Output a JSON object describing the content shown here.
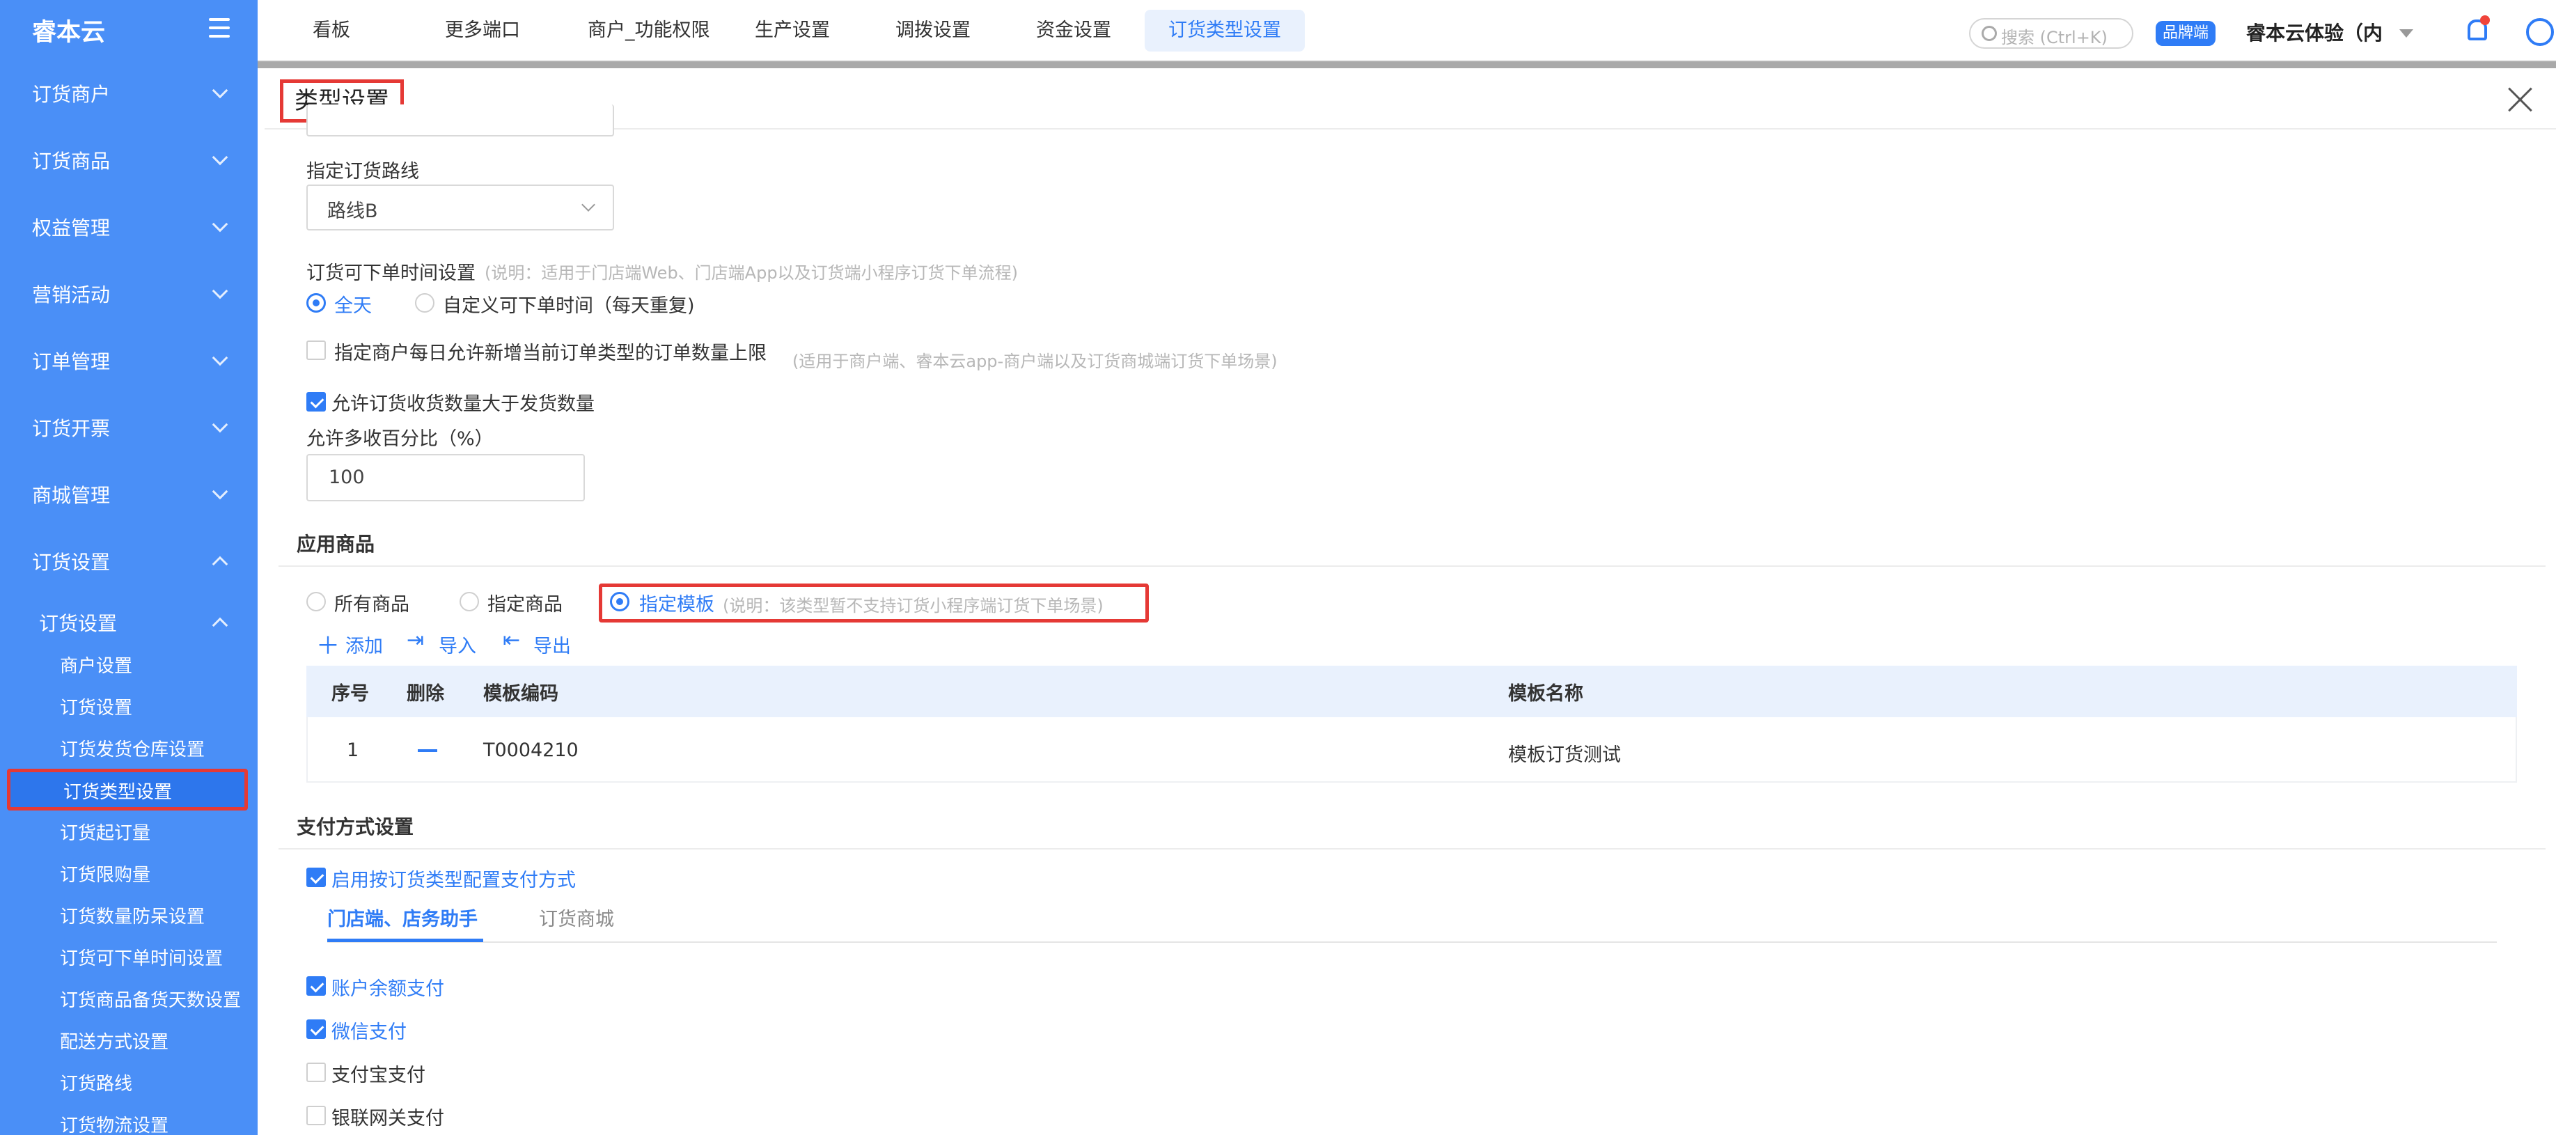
{
  "sidebar": {
    "logo": "睿本云",
    "groups": [
      {
        "label": "订货商户"
      },
      {
        "label": "订货商品"
      },
      {
        "label": "权益管理"
      },
      {
        "label": "营销活动"
      },
      {
        "label": "订单管理"
      },
      {
        "label": "订货开票"
      },
      {
        "label": "商城管理"
      },
      {
        "label": "订货设置"
      }
    ],
    "subgroup": "订货设置",
    "items": [
      {
        "label": "商户设置"
      },
      {
        "label": "订货设置"
      },
      {
        "label": "订货发货仓库设置"
      },
      {
        "label": "订货类型设置"
      },
      {
        "label": "订货起订量"
      },
      {
        "label": "订货限购量"
      },
      {
        "label": "订货数量防呆设置"
      },
      {
        "label": "订货可下单时间设置"
      },
      {
        "label": "订货商品备货天数设置"
      },
      {
        "label": "配送方式设置"
      },
      {
        "label": "订货路线"
      },
      {
        "label": "订货物流设置"
      }
    ]
  },
  "topnav": {
    "tabs": [
      {
        "label": "看板"
      },
      {
        "label": "更多端口"
      },
      {
        "label": "商户_功能权限"
      },
      {
        "label": "生产设置"
      },
      {
        "label": "调拨设置"
      },
      {
        "label": "资金设置"
      },
      {
        "label": "订货类型设置"
      }
    ],
    "search_placeholder": "搜索 (Ctrl+K)",
    "badge": "品牌端",
    "user": "睿本云体验（内"
  },
  "dialog": {
    "title": "类型设置",
    "route_label": "指定订货路线",
    "route_value": "路线B",
    "time_label": "订货可下单时间设置",
    "time_note": "(说明：适用于门店端Web、门店端App以及订货端小程序订货下单流程)",
    "time_opt_all": "全天",
    "time_opt_custom": "自定义可下单时间（每天重复)",
    "limit_label": "指定商户每日允许新增当前订单类型的订单数量上限",
    "limit_note": "(适用于商户端、睿本云app-商户端以及订货商城端订货下单场景)",
    "over_label": "允许订货收货数量大于发货数量",
    "pct_label": "允许多收百分比（%）",
    "pct_value": "100",
    "goods_section": "应用商品",
    "goods_all": "所有商品",
    "goods_specific": "指定商品",
    "goods_template": "指定模板",
    "goods_template_note": "(说明：该类型暂不支持订货小程序端订货下单场景)",
    "tool_add": "添加",
    "tool_import": "导入",
    "tool_export": "导出",
    "table": {
      "headers": [
        "序号",
        "删除",
        "模板编码",
        "模板名称"
      ],
      "rows": [
        {
          "no": "1",
          "code": "T0004210",
          "name": "模板订货测试"
        }
      ]
    },
    "pay_section": "支付方式设置",
    "pay_enable": "启用按订货类型配置支付方式",
    "pay_tabs": [
      "门店端、店务助手",
      "订货商城"
    ],
    "pay_methods": [
      {
        "label": "账户余额支付",
        "checked": true
      },
      {
        "label": "微信支付",
        "checked": true
      },
      {
        "label": "支付宝支付",
        "checked": false
      },
      {
        "label": "银联网关支付",
        "checked": false
      }
    ]
  },
  "colors": {
    "accent": "#2f7cf6",
    "sidebar": "#4a8ff7",
    "highlight": "#e53935"
  }
}
